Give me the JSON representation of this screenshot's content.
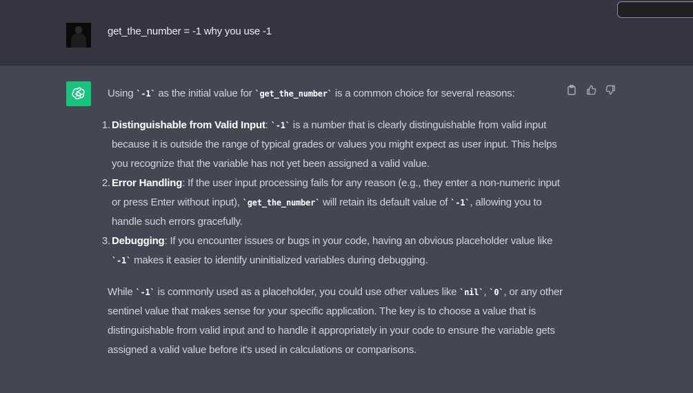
{
  "user_message": {
    "text": "get_the_number = -1 why you use -1"
  },
  "assistant_message": {
    "intro": {
      "t1": "Using ",
      "c1": "`-1`",
      "t2": " as the initial value for ",
      "c2": "`get_the_number`",
      "t3": " is a common choice for several reasons:"
    },
    "items": [
      {
        "num": "1.",
        "title": "Distinguishable from Valid Input",
        "t1": ": ",
        "c1": "`-1`",
        "t2": " is a number that is clearly distinguishable from valid input because it is outside the range of typical grades or values you might expect as user input. This helps you recognize that the variable has not yet been assigned a valid value."
      },
      {
        "num": "2.",
        "title": "Error Handling",
        "t1": ": If the user input processing fails for any reason (e.g., they enter a non-numeric input or press Enter without input), ",
        "c1": "`get_the_number`",
        "t2": " will retain its default value of ",
        "c2": "`-1`",
        "t3": ", allowing you to handle such errors gracefully."
      },
      {
        "num": "3.",
        "title": "Debugging",
        "t1": ": If you encounter issues or bugs in your code, having an obvious placeholder value like ",
        "c1": "`-1`",
        "t2": " makes it easier to identify uninitialized variables during debugging."
      }
    ],
    "closing": {
      "t1": "While ",
      "c1": "`-1`",
      "t2": " is commonly used as a placeholder, you could use other values like ",
      "c2": "`nil`",
      "t3": ", ",
      "c3": "`0`",
      "t4": ", or any other sentinel value that makes sense for your specific application. The key is to choose a value that is distinguishable from valid input and to handle it appropriately in your code to ensure the variable gets assigned a valid value before it's used in calculations or comparisons."
    }
  },
  "icons": {
    "copy": "clipboard-icon",
    "like": "thumbs-up-icon",
    "dislike": "thumbs-down-icon",
    "bot": "openai-logo-icon"
  },
  "colors": {
    "user_bg": "#343541",
    "assistant_bg": "#444654",
    "bot_avatar": "#19c37d"
  }
}
